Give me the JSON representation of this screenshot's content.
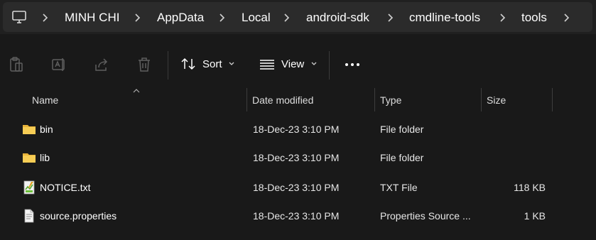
{
  "breadcrumb": {
    "icon": "this-pc-icon",
    "items": [
      "MINH CHI",
      "AppData",
      "Local",
      "android-sdk",
      "cmdline-tools",
      "tools"
    ]
  },
  "toolbar": {
    "icons": [
      "paste-icon",
      "rename-icon",
      "share-icon",
      "delete-icon"
    ],
    "sort_label": "Sort",
    "view_label": "View",
    "more_icon": "more-icon"
  },
  "columns": {
    "name": "Name",
    "date": "Date modified",
    "type": "Type",
    "size": "Size"
  },
  "files": [
    {
      "icon": "folder-icon",
      "name": "bin",
      "date": "18-Dec-23 3:10 PM",
      "type": "File folder",
      "size": ""
    },
    {
      "icon": "folder-icon",
      "name": "lib",
      "date": "18-Dec-23 3:10 PM",
      "type": "File folder",
      "size": ""
    },
    {
      "icon": "text-file-icon",
      "name": "NOTICE.txt",
      "date": "18-Dec-23 3:10 PM",
      "type": "TXT File",
      "size": "118 KB"
    },
    {
      "icon": "document-icon",
      "name": "source.properties",
      "date": "18-Dec-23 3:10 PM",
      "type": "Properties Source ...",
      "size": "1 KB"
    }
  ],
  "colors": {
    "folder": "#f4c542",
    "background": "#191919",
    "address_bg": "#2b2b2b"
  }
}
